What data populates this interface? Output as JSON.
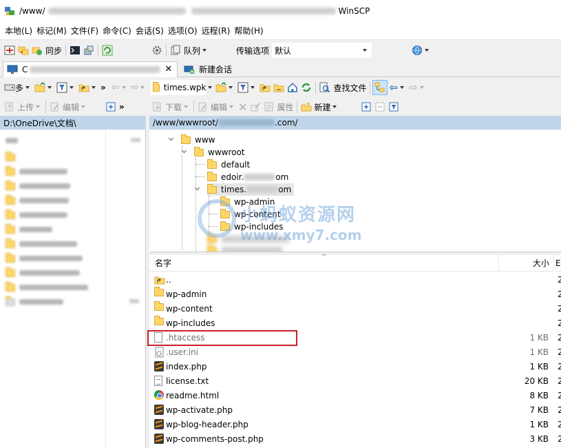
{
  "window": {
    "title_prefix": "/www/",
    "title_suffix": "WinSCP"
  },
  "menu": [
    "本地(L)",
    "标记(M)",
    "文件(F)",
    "命令(C)",
    "会话(S)",
    "选项(O)",
    "远程(R)",
    "帮助(H)"
  ],
  "toolbar1": {
    "sync_label": "同步",
    "queue_label": "队列",
    "transfer_options_label": "传输选项",
    "transfer_options_value": "默认"
  },
  "tabs": {
    "session_prefix": "C",
    "new_session_label": "新建会话"
  },
  "local_toolbar": {
    "path_combo": "多",
    "upload_label": "上传",
    "edit_label": "编辑"
  },
  "remote_toolbar": {
    "path_combo": "times.wpk",
    "find_files_label": "查找文件",
    "download_label": "下载",
    "edit_label": "编辑",
    "properties_label": "属性",
    "new_label": "新建"
  },
  "local_panel": {
    "path": "D:\\OneDrive\\文档\\"
  },
  "remote_panel": {
    "path_prefix": "/www/wwwroot/",
    "path_suffix": ".com/"
  },
  "tree": {
    "root": "www",
    "wwwroot": "wwwroot",
    "default": "default",
    "edoir_prefix": "edoir.",
    "edoir_suffix": "om",
    "times_prefix": "times.",
    "times_suffix": "om",
    "wp_admin": "wp-admin",
    "wp_content": "wp-content",
    "wp_includes": "wp-includes"
  },
  "file_list": {
    "col_name": "名字",
    "col_size": "大小",
    "col_more": "E",
    "parent_dir": "..",
    "rows": [
      {
        "name": "wp-admin",
        "size": "",
        "extra": "2"
      },
      {
        "name": "wp-content",
        "size": "",
        "extra": "2"
      },
      {
        "name": "wp-includes",
        "size": "",
        "extra": "2"
      },
      {
        "name": ".htaccess",
        "size": "1 KB",
        "extra": "2"
      },
      {
        "name": ".user.ini",
        "size": "1 KB",
        "extra": "2"
      },
      {
        "name": "index.php",
        "size": "1 KB",
        "extra": "2"
      },
      {
        "name": "license.txt",
        "size": "20 KB",
        "extra": "2"
      },
      {
        "name": "readme.html",
        "size": "8 KB",
        "extra": "2"
      },
      {
        "name": "wp-activate.php",
        "size": "7 KB",
        "extra": "2"
      },
      {
        "name": "wp-blog-header.php",
        "size": "1 KB",
        "extra": "2"
      },
      {
        "name": "wp-comments-post.php",
        "size": "3 KB",
        "extra": "2"
      }
    ],
    "parent_extra": "2"
  },
  "watermark": {
    "text": "小蚂蚁资源网",
    "url": "www.xmy7.com"
  },
  "colors": {
    "panel_header": "#bfd6ea",
    "highlight_box": "#c8202c",
    "folder": "#ffd766"
  }
}
